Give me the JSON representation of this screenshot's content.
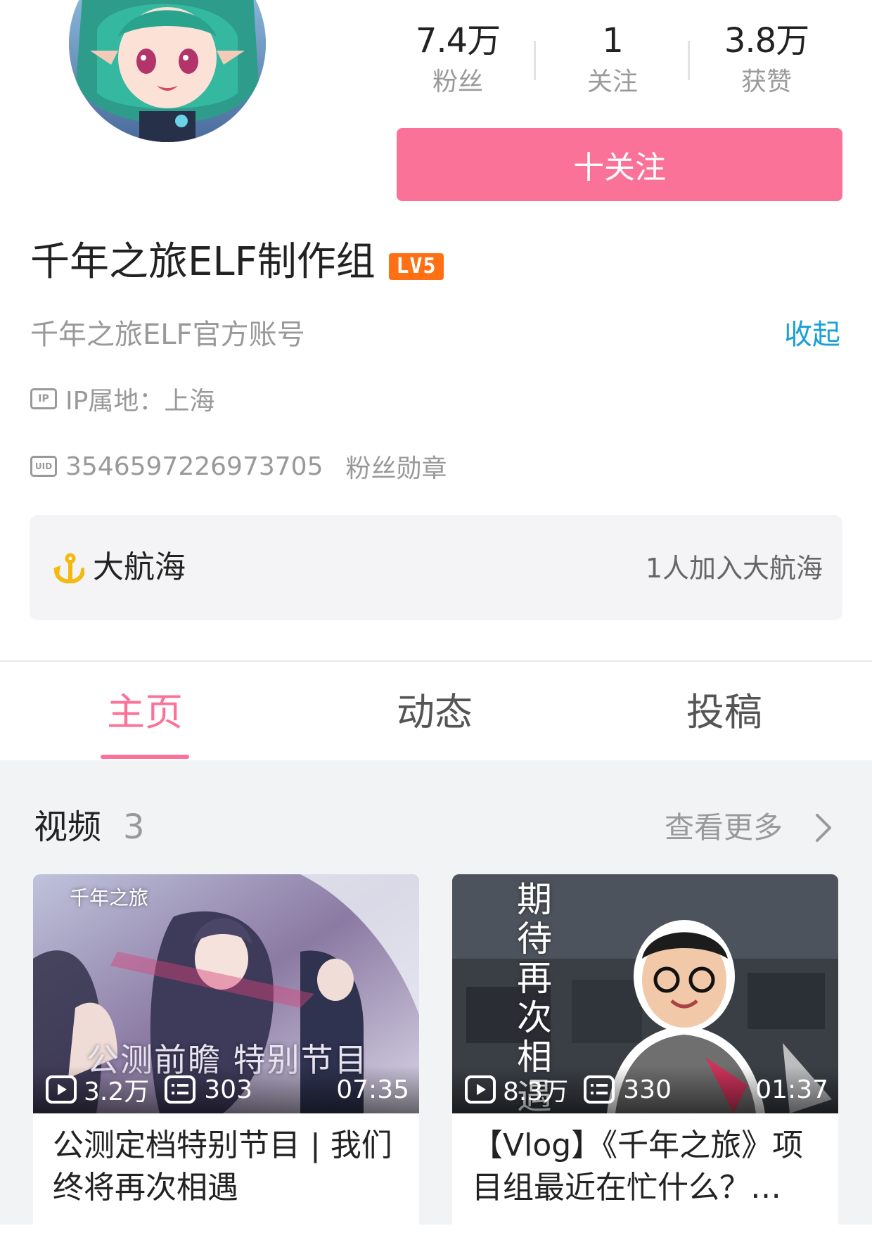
{
  "profile": {
    "stats": [
      {
        "value": "7.4万",
        "label": "粉丝"
      },
      {
        "value": "1",
        "label": "关注"
      },
      {
        "value": "3.8万",
        "label": "获赞"
      }
    ],
    "follow_label": "十关注",
    "name": "千年之旅ELF制作组",
    "level": "LV5",
    "sign": "千年之旅ELF官方账号",
    "collapse_label": "收起",
    "ip_tag": "IP",
    "ip_text": "IP属地：上海",
    "uid_tag": "UID",
    "uid": "3546597226973705",
    "fan_badge_label": "粉丝勋章"
  },
  "guard": {
    "title": "大航海",
    "count_text": "1人加入大航海"
  },
  "tabs": [
    {
      "label": "主页",
      "active": true
    },
    {
      "label": "动态",
      "active": false
    },
    {
      "label": "投稿",
      "active": false
    }
  ],
  "videos_section": {
    "title": "视频",
    "count": "3",
    "more_label": "查看更多"
  },
  "videos": [
    {
      "thumb_caption": "公测前瞻 特别节目",
      "thumb_logo": "千年之旅",
      "plays": "3.2万",
      "danmaku": "303",
      "duration": "07:35",
      "title": "公测定档特别节目 | 我们终将再次相遇"
    },
    {
      "thumb_caption": "期待再次相遇",
      "plays": "8.3万",
      "danmaku": "330",
      "duration": "01:37",
      "title": "【Vlog】《千年之旅》项目组最近在忙什么？…"
    }
  ],
  "colors": {
    "accent": "#fb7299",
    "link": "#1aa1d4",
    "level_badge": "#ff6f14"
  }
}
